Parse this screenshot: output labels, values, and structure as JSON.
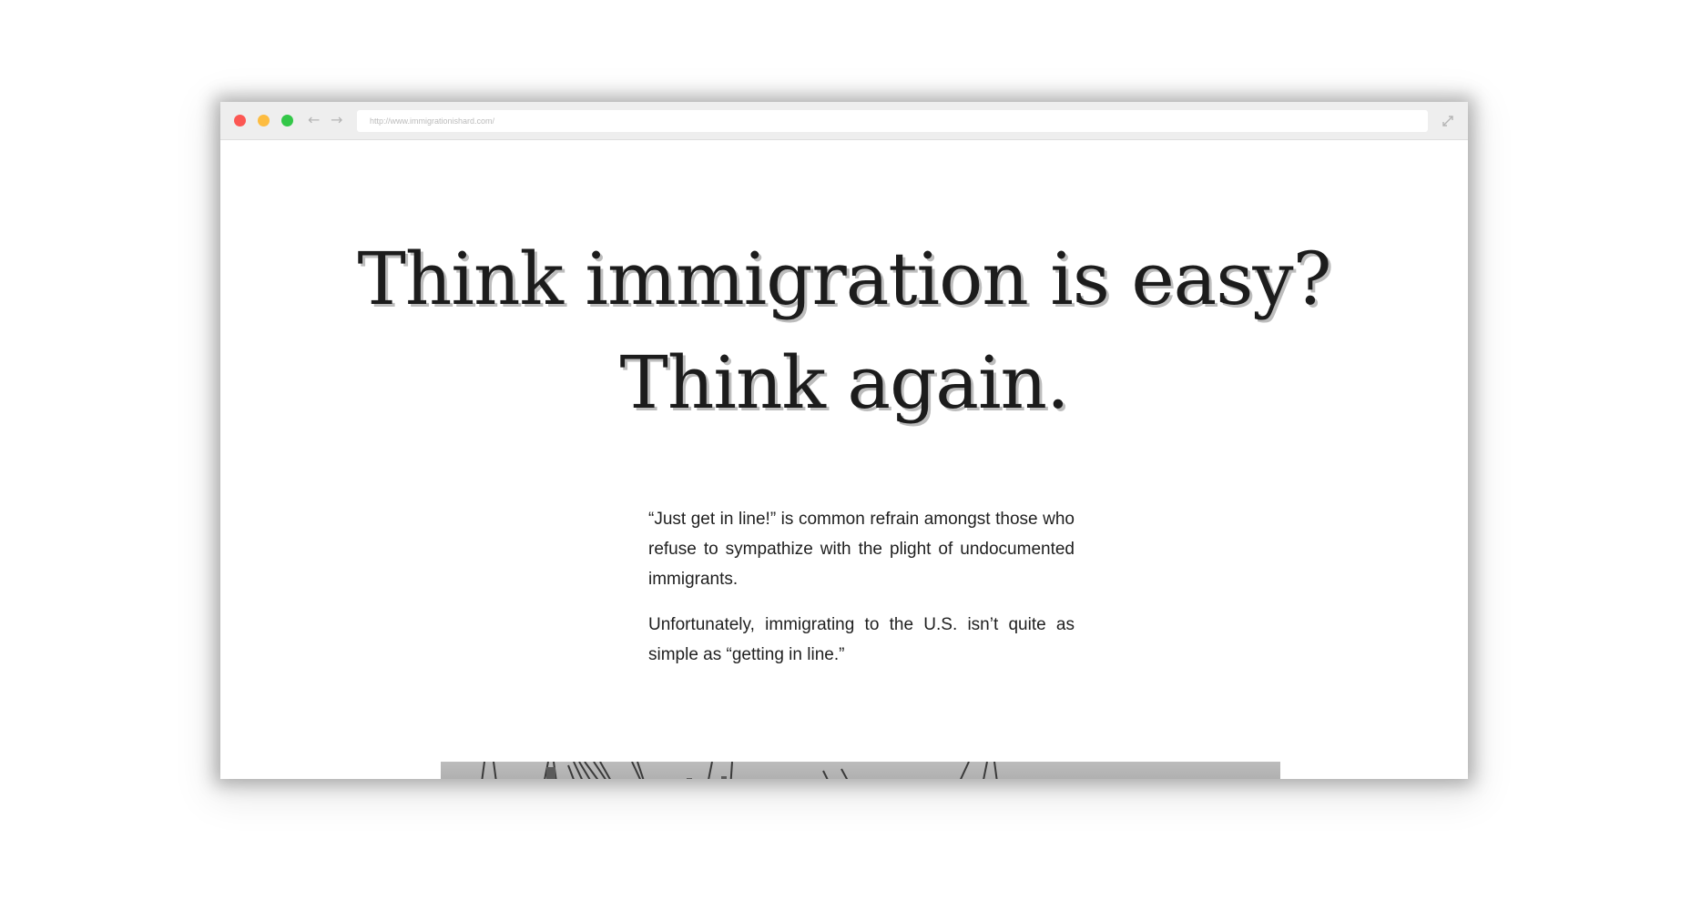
{
  "browser": {
    "url": "http://www.immigrationishard.com/",
    "icons": {
      "close": "red-circle",
      "minimize": "yellow-circle",
      "maximize": "green-circle",
      "back": "arrow-left-icon",
      "forward": "arrow-right-icon",
      "fullscreen": "expand-icon"
    },
    "colors": {
      "close": "#fc5753",
      "minimize": "#fdbc40",
      "maximize": "#33c748"
    }
  },
  "page": {
    "headline_line1": "Think immigration is easy?",
    "headline_line2": "Think again.",
    "paragraph1": "“Just get in line!” is common refrain amongst those who refuse to sympathize with the plight of undocumented immigrants.",
    "paragraph2": "Unfortunately, immigrating to the U.S. isn’t quite as simple as “getting in line.”",
    "image": "grayscale photo of bridge cables (cropped)"
  }
}
